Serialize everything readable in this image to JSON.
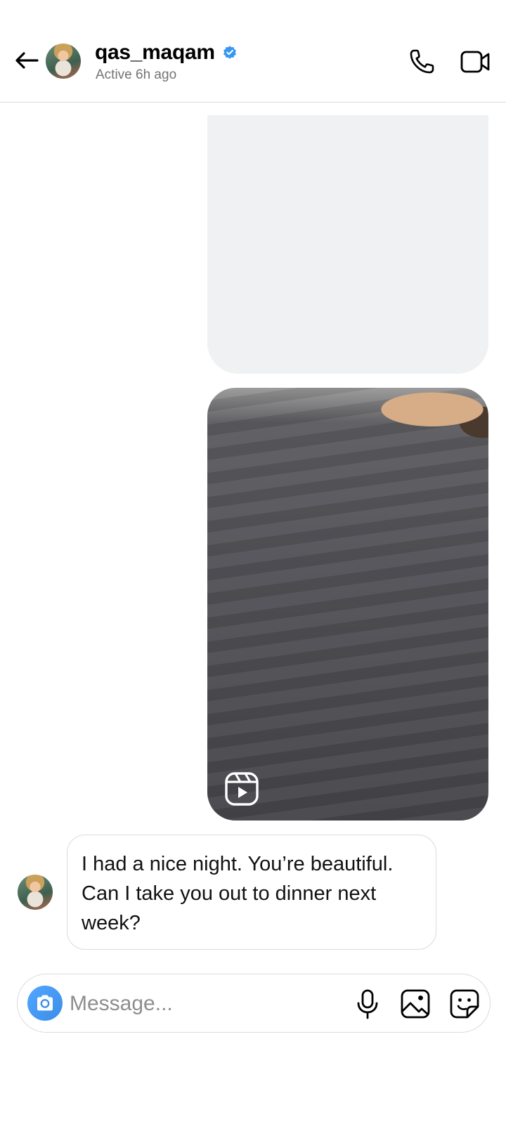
{
  "header": {
    "username": "qas_maqam",
    "status": "Active 6h ago",
    "icons": {
      "back": "back-arrow-icon",
      "verified": "verified-badge-icon",
      "call": "phone-icon",
      "video": "video-camera-icon"
    }
  },
  "messages": [
    {
      "type": "attachment-placeholder",
      "sender": "self"
    },
    {
      "type": "reel",
      "sender": "self",
      "icon": "reels-icon"
    },
    {
      "type": "text",
      "sender": "other",
      "text": "I had a nice night. You’re beautiful. Can I take you out to dinner next week?"
    }
  ],
  "composer": {
    "placeholder": "Message...",
    "icons": {
      "camera": "camera-icon",
      "mic": "microphone-icon",
      "gallery": "image-gallery-icon",
      "sticker": "sticker-icon"
    }
  },
  "colors": {
    "verified": "#3897f0",
    "camera_button": "#3b8ee8",
    "bubble_border": "#dbdbdb",
    "placeholder_bg": "#f0f1f3"
  }
}
